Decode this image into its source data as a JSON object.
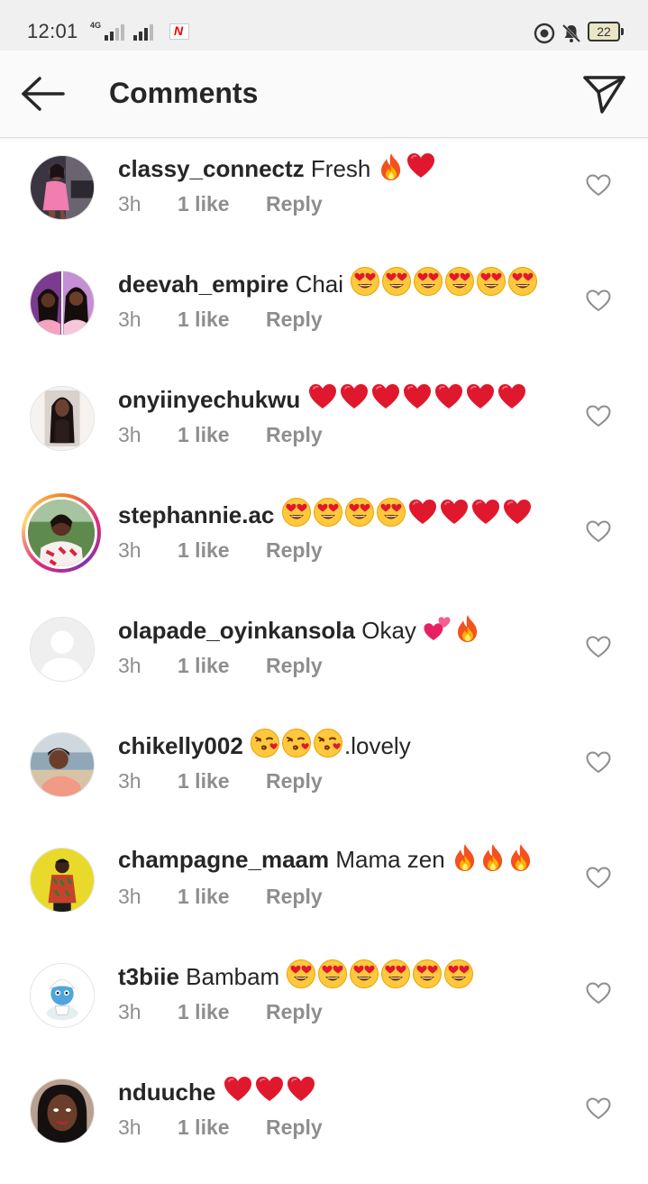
{
  "status_bar": {
    "time": "12:01",
    "network": "4G",
    "battery": "22"
  },
  "header": {
    "title": "Comments",
    "back_icon": "arrow-left-icon",
    "share_icon": "paper-plane-icon"
  },
  "comments": [
    {
      "username": "classy_connectz",
      "text": "Fresh",
      "emojis": [
        "fire",
        "heart"
      ],
      "time": "3h",
      "likes": "1 like",
      "reply": "Reply",
      "avatar": "photo-pink-dress",
      "story": false
    },
    {
      "username": "deevah_empire",
      "text": "Chai",
      "emojis": [
        "heart-eyes",
        "heart-eyes",
        "heart-eyes",
        "heart-eyes",
        "heart-eyes",
        "heart-eyes"
      ],
      "time": "3h",
      "likes": "1 like",
      "reply": "Reply",
      "avatar": "photo-pink-split",
      "story": false
    },
    {
      "username": "onyiinyechukwu",
      "text": "",
      "emojis": [
        "heart",
        "heart",
        "heart",
        "heart",
        "heart",
        "heart",
        "heart"
      ],
      "time": "3h",
      "likes": "1 like",
      "reply": "Reply",
      "avatar": "photo-long-hair",
      "story": false
    },
    {
      "username": "stephannie.ac",
      "text": "",
      "emojis": [
        "heart-eyes",
        "heart-eyes",
        "heart-eyes",
        "heart-eyes",
        "heart",
        "heart",
        "heart",
        "heart"
      ],
      "time": "3h",
      "likes": "1 like",
      "reply": "Reply",
      "avatar": "photo-outdoor",
      "story": true
    },
    {
      "username": "olapade_oyinkansola",
      "text": "Okay",
      "emojis": [
        "two-hearts",
        "fire"
      ],
      "time": "3h",
      "likes": "1 like",
      "reply": "Reply",
      "avatar": "default-avatar",
      "story": false
    },
    {
      "username": "chikelly002",
      "text": ".lovely",
      "emojis": [
        "kiss",
        "kiss",
        "kiss"
      ],
      "text_after": true,
      "time": "3h",
      "likes": "1 like",
      "reply": "Reply",
      "avatar": "photo-beach",
      "story": false
    },
    {
      "username": "champagne_maam",
      "text": "Mama zen",
      "emojis": [
        "fire",
        "fire",
        "fire"
      ],
      "time": "3h",
      "likes": "1 like",
      "reply": "Reply",
      "avatar": "photo-yellow-bg",
      "story": false
    },
    {
      "username": "t3biie",
      "text": "Bambam",
      "emojis": [
        "heart-eyes",
        "heart-eyes",
        "heart-eyes",
        "heart-eyes",
        "heart-eyes",
        "heart-eyes"
      ],
      "time": "3h",
      "likes": "1 like",
      "reply": "Reply",
      "avatar": "photo-cartoon",
      "story": false
    },
    {
      "username": "nduuche",
      "text": "",
      "emojis": [
        "heart",
        "heart",
        "heart"
      ],
      "time": "3h",
      "likes": "1 like",
      "reply": "Reply",
      "avatar": "photo-portrait",
      "story": false
    }
  ],
  "colors": {
    "text": "#262626",
    "meta": "#8e8e8e",
    "heart_red": "#e0182d",
    "header_bg": "#fafafa"
  }
}
